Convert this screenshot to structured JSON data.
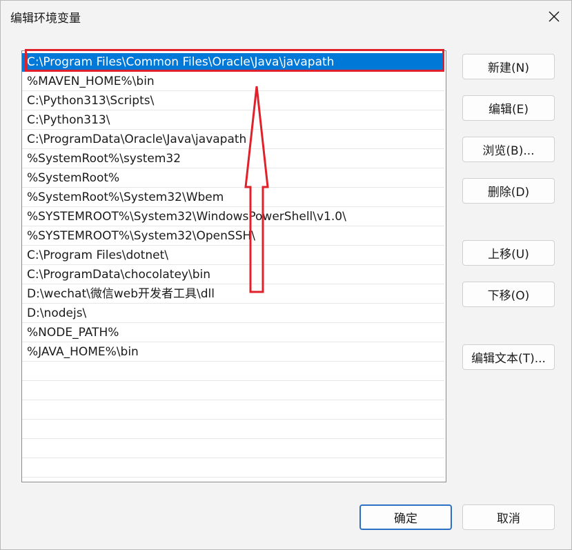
{
  "dialog": {
    "title": "编辑环境变量"
  },
  "list": {
    "items": [
      "C:\\Program Files\\Common Files\\Oracle\\Java\\javapath",
      "%MAVEN_HOME%\\bin",
      "C:\\Python313\\Scripts\\",
      "C:\\Python313\\",
      "C:\\ProgramData\\Oracle\\Java\\javapath",
      "%SystemRoot%\\system32",
      "%SystemRoot%",
      "%SystemRoot%\\System32\\Wbem",
      "%SYSTEMROOT%\\System32\\WindowsPowerShell\\v1.0\\",
      "%SYSTEMROOT%\\System32\\OpenSSH\\",
      "C:\\Program Files\\dotnet\\",
      "C:\\ProgramData\\chocolatey\\bin",
      "D:\\wechat\\微信web开发者工具\\dll",
      "D:\\nodejs\\",
      "%NODE_PATH%",
      "%JAVA_HOME%\\bin"
    ],
    "selected_index": 0
  },
  "buttons": {
    "new": "新建(N)",
    "edit": "编辑(E)",
    "browse": "浏览(B)...",
    "delete": "删除(D)",
    "move_up": "上移(U)",
    "move_down": "下移(O)",
    "edit_text": "编辑文本(T)...",
    "ok": "确定",
    "cancel": "取消"
  },
  "annotation": {
    "color": "#e0202a",
    "icons": [
      "highlight-box",
      "up-arrow-icon"
    ]
  },
  "colors": {
    "selection": "#0078d7",
    "accent": "#2b6fc4"
  }
}
